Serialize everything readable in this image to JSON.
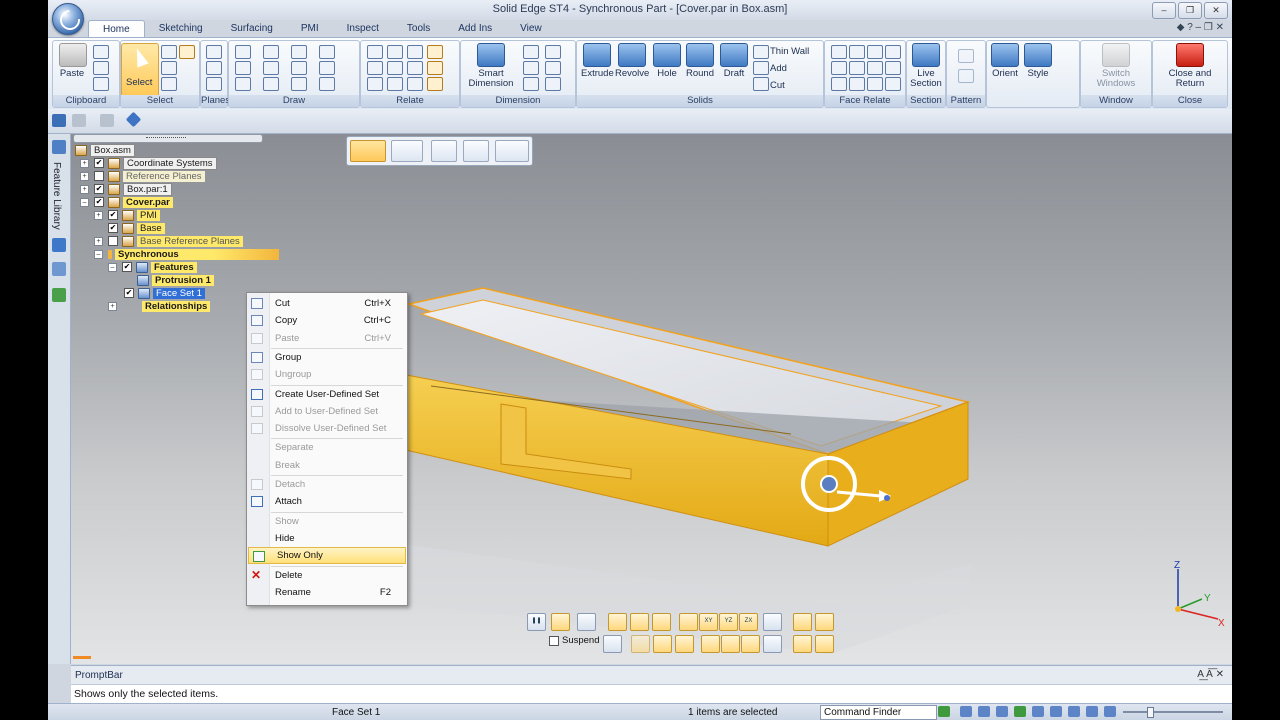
{
  "window": {
    "title": "Solid Edge ST4 - Synchronous Part - [Cover.par in Box.asm]",
    "controls": [
      "–",
      "❐",
      "✕"
    ],
    "help_cluster": "◆ ? – ❐ ✕"
  },
  "tabs": [
    "Home",
    "Sketching",
    "Surfacing",
    "PMI",
    "Inspect",
    "Tools",
    "Add Ins",
    "View"
  ],
  "ribbon": {
    "groups": {
      "clipboard": "Clipboard",
      "select": "Select",
      "planes": "Planes",
      "draw": "Draw",
      "relate": "Relate",
      "dimension": "Dimension",
      "solids": "Solids",
      "face_relate": "Face Relate",
      "section": "Section",
      "pattern": "Pattern",
      "window": "Window",
      "close": "Close"
    },
    "buttons": {
      "paste": "Paste",
      "select": "Select",
      "smart_dimension_1": "Smart",
      "smart_dimension_2": "Dimension",
      "extrude": "Extrude",
      "revolve": "Revolve",
      "hole": "Hole",
      "round": "Round",
      "draft": "Draft",
      "thin_wall": "Thin Wall",
      "add": "Add",
      "cut": "Cut",
      "live_section_1": "Live",
      "live_section_2": "Section",
      "orient": "Orient",
      "style": "Style",
      "switch_windows_1": "Switch",
      "switch_windows_2": "Windows",
      "close_return_1": "Close and",
      "close_return_2": "Return"
    }
  },
  "tree": {
    "root": "Box.asm",
    "items": [
      {
        "label": "Coordinate Systems"
      },
      {
        "label": "Reference Planes"
      },
      {
        "label": "Box.par:1"
      },
      {
        "label": "Cover.par"
      },
      {
        "label": "PMI"
      },
      {
        "label": "Base"
      },
      {
        "label": "Base Reference Planes"
      },
      {
        "label": "Synchronous"
      },
      {
        "label": "Features"
      },
      {
        "label": "Protrusion 1"
      },
      {
        "label": "Face Set 1"
      },
      {
        "label": "Relationships"
      }
    ]
  },
  "dock": {
    "feature_library": "Feature Library"
  },
  "context_menu": {
    "items": [
      {
        "label": "Cut",
        "shortcut": "Ctrl+X"
      },
      {
        "label": "Copy",
        "shortcut": "Ctrl+C"
      },
      {
        "label": "Paste",
        "shortcut": "Ctrl+V"
      },
      {
        "label": "Group",
        "shortcut": ""
      },
      {
        "label": "Ungroup",
        "shortcut": ""
      },
      {
        "label": "Create User-Defined Set",
        "shortcut": ""
      },
      {
        "label": "Add to User-Defined Set",
        "shortcut": ""
      },
      {
        "label": "Dissolve User-Defined Set",
        "shortcut": ""
      },
      {
        "label": "Separate",
        "shortcut": ""
      },
      {
        "label": "Break",
        "shortcut": ""
      },
      {
        "label": "Detach",
        "shortcut": ""
      },
      {
        "label": "Attach",
        "shortcut": ""
      },
      {
        "label": "Show",
        "shortcut": ""
      },
      {
        "label": "Hide",
        "shortcut": ""
      },
      {
        "label": "Show Only",
        "shortcut": ""
      },
      {
        "label": "Delete",
        "shortcut": ""
      },
      {
        "label": "Rename",
        "shortcut": "F2"
      }
    ]
  },
  "command_bar": {
    "suspend": "Suspend",
    "plane_labels": [
      "XY",
      "YZ",
      "ZX"
    ]
  },
  "triad": {
    "z": "Z",
    "y": "Y",
    "x": "X"
  },
  "prompt_bar": {
    "title": "PromptBar",
    "message": "Shows only the selected items.",
    "tools": "A͟ A͞ ✕"
  },
  "status_bar": {
    "selection": "Face Set 1",
    "count": "1 items are selected",
    "command_finder": "Command Finder"
  },
  "colors": {
    "accent_yellow": "#ffe96a",
    "selection_blue": "#2f6fd6",
    "model_gold": "#f2b824",
    "delete_red": "#d01a10"
  }
}
